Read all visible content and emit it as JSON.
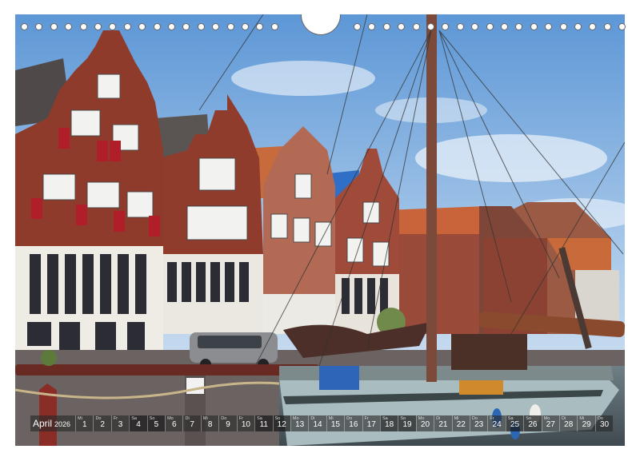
{
  "calendar": {
    "month": "April",
    "year": "2026",
    "days": [
      {
        "n": "1",
        "wd": "Mi"
      },
      {
        "n": "2",
        "wd": "Do"
      },
      {
        "n": "3",
        "wd": "Fr"
      },
      {
        "n": "4",
        "wd": "Sa"
      },
      {
        "n": "5",
        "wd": "So"
      },
      {
        "n": "6",
        "wd": "Mo"
      },
      {
        "n": "7",
        "wd": "Di"
      },
      {
        "n": "8",
        "wd": "Mi"
      },
      {
        "n": "9",
        "wd": "Do"
      },
      {
        "n": "10",
        "wd": "Fr"
      },
      {
        "n": "11",
        "wd": "Sa"
      },
      {
        "n": "12",
        "wd": "So"
      },
      {
        "n": "13",
        "wd": "Mo"
      },
      {
        "n": "14",
        "wd": "Di"
      },
      {
        "n": "15",
        "wd": "Mi"
      },
      {
        "n": "16",
        "wd": "Do"
      },
      {
        "n": "17",
        "wd": "Fr"
      },
      {
        "n": "18",
        "wd": "Sa"
      },
      {
        "n": "19",
        "wd": "So"
      },
      {
        "n": "20",
        "wd": "Mo"
      },
      {
        "n": "21",
        "wd": "Di"
      },
      {
        "n": "22",
        "wd": "Mi"
      },
      {
        "n": "23",
        "wd": "Do"
      },
      {
        "n": "24",
        "wd": "Fr"
      },
      {
        "n": "25",
        "wd": "Sa"
      },
      {
        "n": "26",
        "wd": "So"
      },
      {
        "n": "27",
        "wd": "Mo"
      },
      {
        "n": "28",
        "wd": "Di"
      },
      {
        "n": "29",
        "wd": "Mi"
      },
      {
        "n": "30",
        "wd": "Do"
      }
    ]
  },
  "colors": {
    "sky": "#7fb0e0",
    "brick": "#8a3a2c",
    "shutter": "#b01e2a",
    "calendar_bar": "#3a3a3a"
  }
}
